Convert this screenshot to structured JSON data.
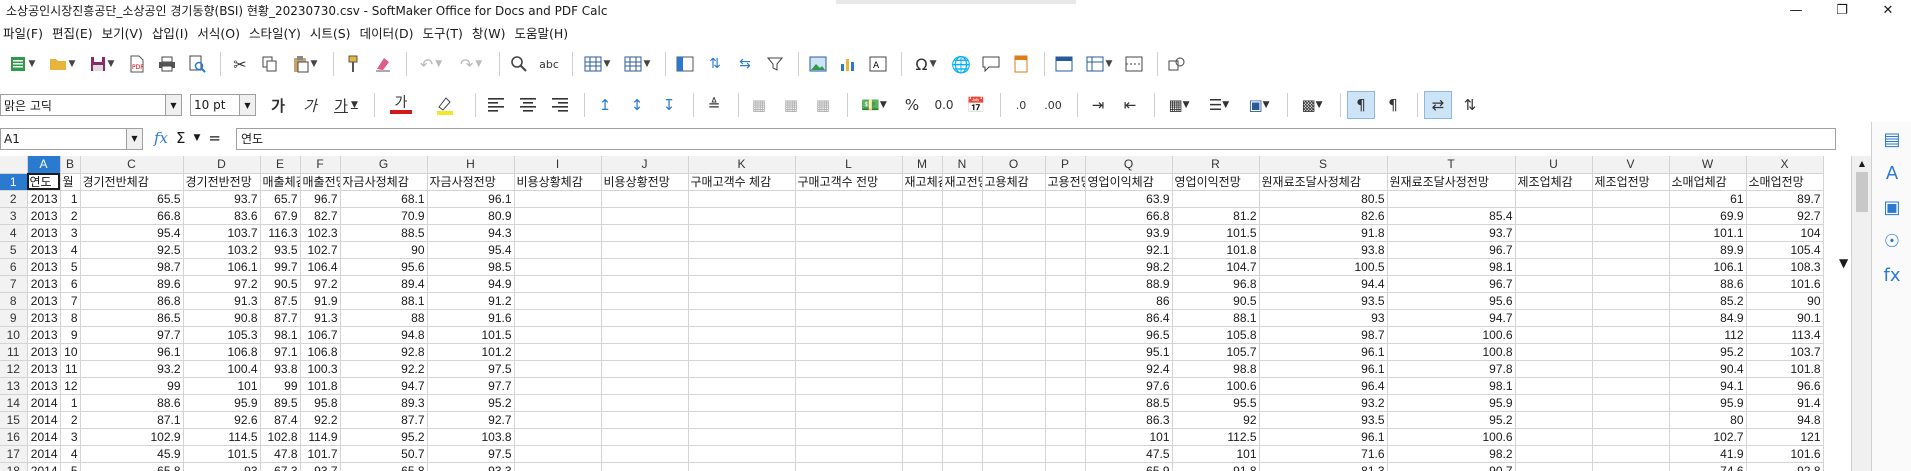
{
  "window": {
    "title": "소상공인시장진흥공단_소상공인 경기동향(BSI) 현황_20230730.csv - SoftMaker Office for Docs and PDF Calc",
    "progress": 0
  },
  "menu": [
    "파일(F)",
    "편집(E)",
    "보기(V)",
    "삽입(I)",
    "서식(O)",
    "스타일(Y)",
    "시트(S)",
    "데이터(D)",
    "도구(T)",
    "창(W)",
    "도움말(H)"
  ],
  "font": {
    "name": "맑은 고딕",
    "size": "10 pt"
  },
  "format_labels": {
    "bold": "가",
    "italic": "가",
    "underline": "가",
    "fontcolor": "가",
    "percent": "%",
    "decimal": "0.0",
    "inc_decimal": ".0",
    "dec_decimal": ".00"
  },
  "namebox": "A1",
  "formula": "연도",
  "icons": {
    "new": "new-document-icon",
    "open": "folder-open-icon",
    "save": "save-icon",
    "pdf": "pdf-icon",
    "print": "print-icon",
    "preview": "print-preview-icon",
    "cut": "cut-icon",
    "copy": "copy-icon",
    "paste": "paste-icon",
    "clone": "clone-format-icon",
    "clear": "clear-format-icon",
    "undo": "undo-icon",
    "redo": "redo-icon",
    "find": "find-replace-icon",
    "spell": "spellcheck-icon",
    "row": "row-icon",
    "col": "column-icon",
    "image": "image-icon",
    "chart": "chart-icon",
    "special": "special-char-icon",
    "link": "hyperlink-icon",
    "comment": "comment-icon",
    "header": "header-footer-icon",
    "shape": "shape-icon"
  },
  "columns": [
    {
      "letter": "A",
      "header": "연도",
      "w": 33
    },
    {
      "letter": "B",
      "header": "월",
      "w": 20
    },
    {
      "letter": "C",
      "header": "경기전반체감",
      "w": 103
    },
    {
      "letter": "D",
      "header": "경기전반전망",
      "w": 77
    },
    {
      "letter": "E",
      "header": "매출체감",
      "w": 40
    },
    {
      "letter": "F",
      "header": "매출전망",
      "w": 40
    },
    {
      "letter": "G",
      "header": "자금사정체감",
      "w": 87
    },
    {
      "letter": "H",
      "header": "자금사정전망",
      "w": 87
    },
    {
      "letter": "I",
      "header": "비용상황체감",
      "w": 87
    },
    {
      "letter": "J",
      "header": "비용상황전망",
      "w": 87
    },
    {
      "letter": "K",
      "header": "구매고객수 체감",
      "w": 107
    },
    {
      "letter": "L",
      "header": "구매고객수 전망",
      "w": 107
    },
    {
      "letter": "M",
      "header": "재고체감",
      "w": 40
    },
    {
      "letter": "N",
      "header": "재고전망",
      "w": 40
    },
    {
      "letter": "O",
      "header": "고용체감",
      "w": 63
    },
    {
      "letter": "P",
      "header": "고용전망",
      "w": 40
    },
    {
      "letter": "Q",
      "header": "영업이익체감",
      "w": 87
    },
    {
      "letter": "R",
      "header": "영업이익전망",
      "w": 87
    },
    {
      "letter": "S",
      "header": "원재료조달사정체감",
      "w": 128
    },
    {
      "letter": "T",
      "header": "원재료조달사정전망",
      "w": 128
    },
    {
      "letter": "U",
      "header": "제조업체감",
      "w": 77
    },
    {
      "letter": "V",
      "header": "제조업전망",
      "w": 77
    },
    {
      "letter": "W",
      "header": "소매업체감",
      "w": 77
    },
    {
      "letter": "X",
      "header": "소매업전망",
      "w": 77
    }
  ],
  "rows": [
    [
      "2013",
      "1",
      "65.5",
      "93.7",
      "65.7",
      "96.7",
      "68.1",
      "96.1",
      "",
      "",
      "",
      "",
      "",
      "",
      "",
      "",
      "63.9",
      "",
      "80.5",
      "",
      "",
      "",
      "61",
      "89.7"
    ],
    [
      "2013",
      "2",
      "66.8",
      "83.6",
      "67.9",
      "82.7",
      "70.9",
      "80.9",
      "",
      "",
      "",
      "",
      "",
      "",
      "",
      "",
      "66.8",
      "81.2",
      "82.6",
      "85.4",
      "",
      "",
      "69.9",
      "92.7"
    ],
    [
      "2013",
      "3",
      "95.4",
      "103.7",
      "116.3",
      "102.3",
      "88.5",
      "94.3",
      "",
      "",
      "",
      "",
      "",
      "",
      "",
      "",
      "93.9",
      "101.5",
      "91.8",
      "93.7",
      "",
      "",
      "101.1",
      "104"
    ],
    [
      "2013",
      "4",
      "92.5",
      "103.2",
      "93.5",
      "102.7",
      "90",
      "95.4",
      "",
      "",
      "",
      "",
      "",
      "",
      "",
      "",
      "92.1",
      "101.8",
      "93.8",
      "96.7",
      "",
      "",
      "89.9",
      "105.4"
    ],
    [
      "2013",
      "5",
      "98.7",
      "106.1",
      "99.7",
      "106.4",
      "95.6",
      "98.5",
      "",
      "",
      "",
      "",
      "",
      "",
      "",
      "",
      "98.2",
      "104.7",
      "100.5",
      "98.1",
      "",
      "",
      "106.1",
      "108.3"
    ],
    [
      "2013",
      "6",
      "89.6",
      "97.2",
      "90.5",
      "97.2",
      "89.4",
      "94.9",
      "",
      "",
      "",
      "",
      "",
      "",
      "",
      "",
      "88.9",
      "96.8",
      "94.4",
      "96.7",
      "",
      "",
      "88.6",
      "101.6"
    ],
    [
      "2013",
      "7",
      "86.8",
      "91.3",
      "87.5",
      "91.9",
      "88.1",
      "91.2",
      "",
      "",
      "",
      "",
      "",
      "",
      "",
      "",
      "86",
      "90.5",
      "93.5",
      "95.6",
      "",
      "",
      "85.2",
      "90"
    ],
    [
      "2013",
      "8",
      "86.5",
      "90.8",
      "87.7",
      "91.3",
      "88",
      "91.6",
      "",
      "",
      "",
      "",
      "",
      "",
      "",
      "",
      "86.4",
      "88.1",
      "93",
      "94.7",
      "",
      "",
      "84.9",
      "90.1"
    ],
    [
      "2013",
      "9",
      "97.7",
      "105.3",
      "98.1",
      "106.7",
      "94.8",
      "101.5",
      "",
      "",
      "",
      "",
      "",
      "",
      "",
      "",
      "96.5",
      "105.8",
      "98.7",
      "100.6",
      "",
      "",
      "112",
      "113.4"
    ],
    [
      "2013",
      "10",
      "96.1",
      "106.8",
      "97.1",
      "106.8",
      "92.8",
      "101.2",
      "",
      "",
      "",
      "",
      "",
      "",
      "",
      "",
      "95.1",
      "105.7",
      "96.1",
      "100.8",
      "",
      "",
      "95.2",
      "103.7"
    ],
    [
      "2013",
      "11",
      "93.2",
      "100.4",
      "93.8",
      "100.3",
      "92.2",
      "97.5",
      "",
      "",
      "",
      "",
      "",
      "",
      "",
      "",
      "92.4",
      "98.8",
      "96.1",
      "97.8",
      "",
      "",
      "90.4",
      "101.8"
    ],
    [
      "2013",
      "12",
      "99",
      "101",
      "99",
      "101.8",
      "94.7",
      "97.7",
      "",
      "",
      "",
      "",
      "",
      "",
      "",
      "",
      "97.6",
      "100.6",
      "96.4",
      "98.1",
      "",
      "",
      "94.1",
      "96.6"
    ],
    [
      "2014",
      "1",
      "88.6",
      "95.9",
      "89.5",
      "95.8",
      "89.3",
      "95.2",
      "",
      "",
      "",
      "",
      "",
      "",
      "",
      "",
      "88.5",
      "95.5",
      "93.2",
      "95.9",
      "",
      "",
      "95.9",
      "91.4"
    ],
    [
      "2014",
      "2",
      "87.1",
      "92.6",
      "87.4",
      "92.2",
      "87.7",
      "92.7",
      "",
      "",
      "",
      "",
      "",
      "",
      "",
      "",
      "86.3",
      "92",
      "93.5",
      "95.2",
      "",
      "",
      "80",
      "94.8"
    ],
    [
      "2014",
      "3",
      "102.9",
      "114.5",
      "102.8",
      "114.9",
      "95.2",
      "103.8",
      "",
      "",
      "",
      "",
      "",
      "",
      "",
      "",
      "101",
      "112.5",
      "96.1",
      "100.6",
      "",
      "",
      "102.7",
      "121"
    ],
    [
      "2014",
      "4",
      "45.9",
      "101.5",
      "47.8",
      "101.7",
      "50.7",
      "97.5",
      "",
      "",
      "",
      "",
      "",
      "",
      "",
      "",
      "47.5",
      "101",
      "71.6",
      "98.2",
      "",
      "",
      "41.9",
      "101.6"
    ],
    [
      "2014",
      "5",
      "65.8",
      "93",
      "67.3",
      "93.7",
      "65.8",
      "93.3",
      "",
      "",
      "",
      "",
      "",
      "",
      "",
      "",
      "65.9",
      "91.8",
      "81.3",
      "90.7",
      "",
      "",
      "74.6",
      "92.8"
    ]
  ],
  "sidebar_icons": [
    "properties-icon",
    "styles-icon",
    "gallery-icon",
    "navigator-icon",
    "functions-icon"
  ]
}
